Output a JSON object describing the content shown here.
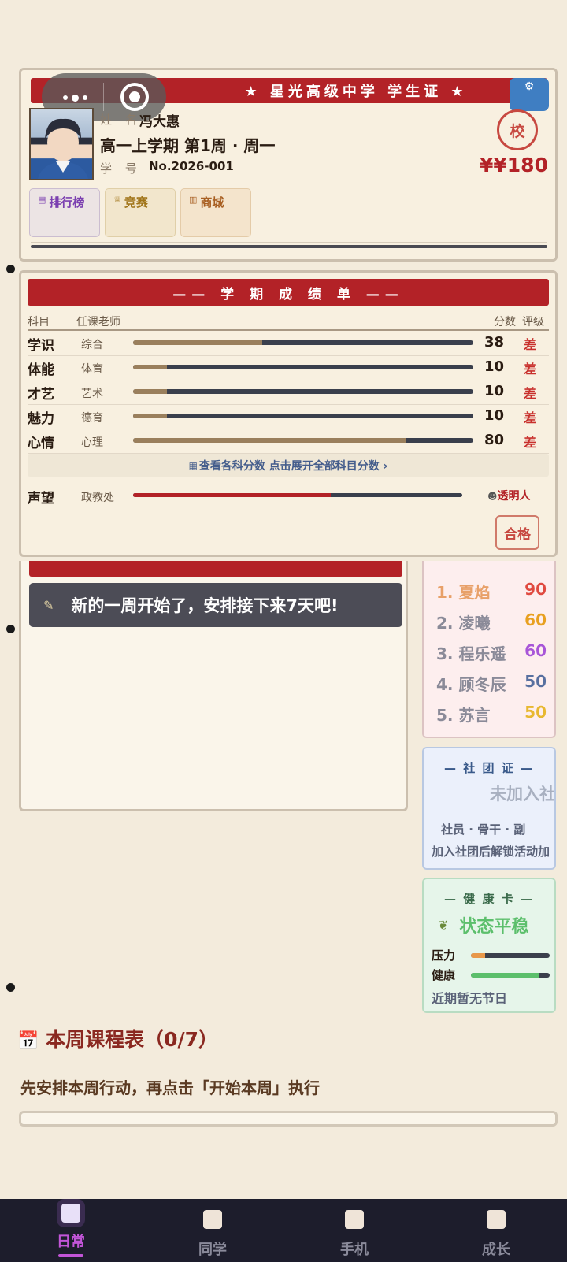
{
  "student_card": {
    "banner": "★ 星光高级中学 学生证 ★",
    "name_label": "姓 名",
    "name": "冯大惠",
    "term": "高一上学期 第1周 · 周一",
    "id_label": "学 号",
    "id": "No.2026-001",
    "seal": "校",
    "money": "¥¥180",
    "buttons": [
      {
        "label": "排行榜",
        "color": "#7b3fb0"
      },
      {
        "label": "竞赛",
        "color": "#a07418"
      },
      {
        "label": "商城",
        "color": "#a85f22"
      }
    ]
  },
  "grades": {
    "title": "—— 学 期 成 绩 单 ——",
    "col_subject": "科目",
    "col_teacher": "任课老师",
    "col_score": "分数",
    "col_grade": "评级",
    "rows": [
      {
        "subject": "学识",
        "teacher": "综合",
        "score": "38",
        "grade": "差",
        "progress": 0.38
      },
      {
        "subject": "体能",
        "teacher": "体育",
        "score": "10",
        "grade": "差",
        "progress": 0.1
      },
      {
        "subject": "才艺",
        "teacher": "艺术",
        "score": "10",
        "grade": "差",
        "progress": 0.1
      },
      {
        "subject": "魅力",
        "teacher": "德育",
        "score": "10",
        "grade": "差",
        "progress": 0.1
      },
      {
        "subject": "心情",
        "teacher": "心理",
        "score": "80",
        "grade": "差",
        "progress": 0.8
      }
    ],
    "expand_text": "查看各科分数 点击展开全部科目分数 ›",
    "prestige": {
      "label": "声望",
      "dept": "政教处",
      "status": "透明人",
      "progress": 0.6
    },
    "pass_stamp": "合格"
  },
  "diary": {
    "message": "新的一周开始了，安排接下来7天吧!"
  },
  "ranking": [
    {
      "rank": "1.",
      "name": "夏焰",
      "score": "90",
      "color": "#e8a068",
      "score_color": "#e04a40"
    },
    {
      "rank": "2.",
      "name": "凌曦",
      "score": "60",
      "color": "#8a8a98",
      "score_color": "#e8a020"
    },
    {
      "rank": "3.",
      "name": "程乐遥",
      "score": "60",
      "color": "#8a8a98",
      "score_color": "#a855d8"
    },
    {
      "rank": "4.",
      "name": "顾冬辰",
      "score": "50",
      "color": "#8a8a98",
      "score_color": "#5870a0"
    },
    {
      "rank": "5.",
      "name": "苏言",
      "score": "50",
      "color": "#8a8a98",
      "score_color": "#e8b830"
    }
  ],
  "club": {
    "title": "— 社 团 证 —",
    "status": "未加入社",
    "roles": "社员 · 骨干 · 副",
    "hint": "加入社团后解锁活动加"
  },
  "health": {
    "title": "— 健 康 卡 —",
    "status": "状态平稳",
    "stress_label": "压力",
    "stress": 0.18,
    "health_label": "健康",
    "health": 0.86,
    "festival": "近期暂无节日"
  },
  "schedule": {
    "title": "本周课程表（0/7）",
    "subtitle": "先安排本周行动，再点击「开始本周」执行"
  },
  "tabs": [
    {
      "label": "日常",
      "active": true
    },
    {
      "label": "同学",
      "active": false
    },
    {
      "label": "手机",
      "active": false
    },
    {
      "label": "成长",
      "active": false
    }
  ]
}
